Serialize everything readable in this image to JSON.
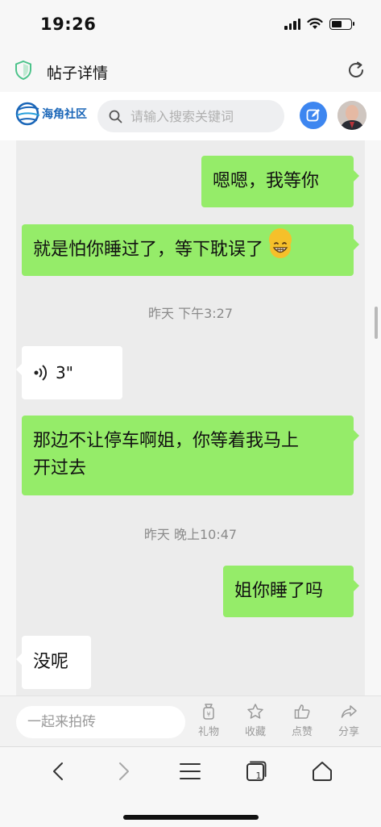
{
  "status_bar": {
    "time": "19:26",
    "battery_level": 0.55
  },
  "title_bar": {
    "title": "帖子详情"
  },
  "site_header": {
    "logo_text": "海角社区",
    "search_placeholder": "请输入搜索关键词"
  },
  "chat": {
    "messages": [
      {
        "side": "right",
        "text": "嗯嗯，我等你"
      },
      {
        "side": "right",
        "text": "就是怕你睡过了，等下耽误了",
        "emoji": "grinning-face"
      },
      {
        "type": "timestamp",
        "text": "昨天 下午3:27"
      },
      {
        "side": "left",
        "type": "voice",
        "duration": "3\""
      },
      {
        "side": "right",
        "text_line1": "那边不让停车啊姐，你等着我马上",
        "text_line2": "开过去"
      },
      {
        "type": "timestamp",
        "text": "昨天 晚上10:47"
      },
      {
        "side": "right",
        "text": "姐你睡了吗"
      },
      {
        "side": "left",
        "text": "没呢"
      }
    ]
  },
  "bottom_bar": {
    "comment_placeholder": "一起来拍砖",
    "actions": [
      {
        "label": "礼物",
        "icon": "gift-icon"
      },
      {
        "label": "收藏",
        "icon": "star-icon"
      },
      {
        "label": "点赞",
        "icon": "thumbs-up-icon"
      },
      {
        "label": "分享",
        "icon": "share-icon"
      }
    ]
  },
  "browser": {
    "tab_count": "1"
  },
  "colors": {
    "bubble_green": "#95ec69",
    "accent_blue": "#3d86f0"
  }
}
